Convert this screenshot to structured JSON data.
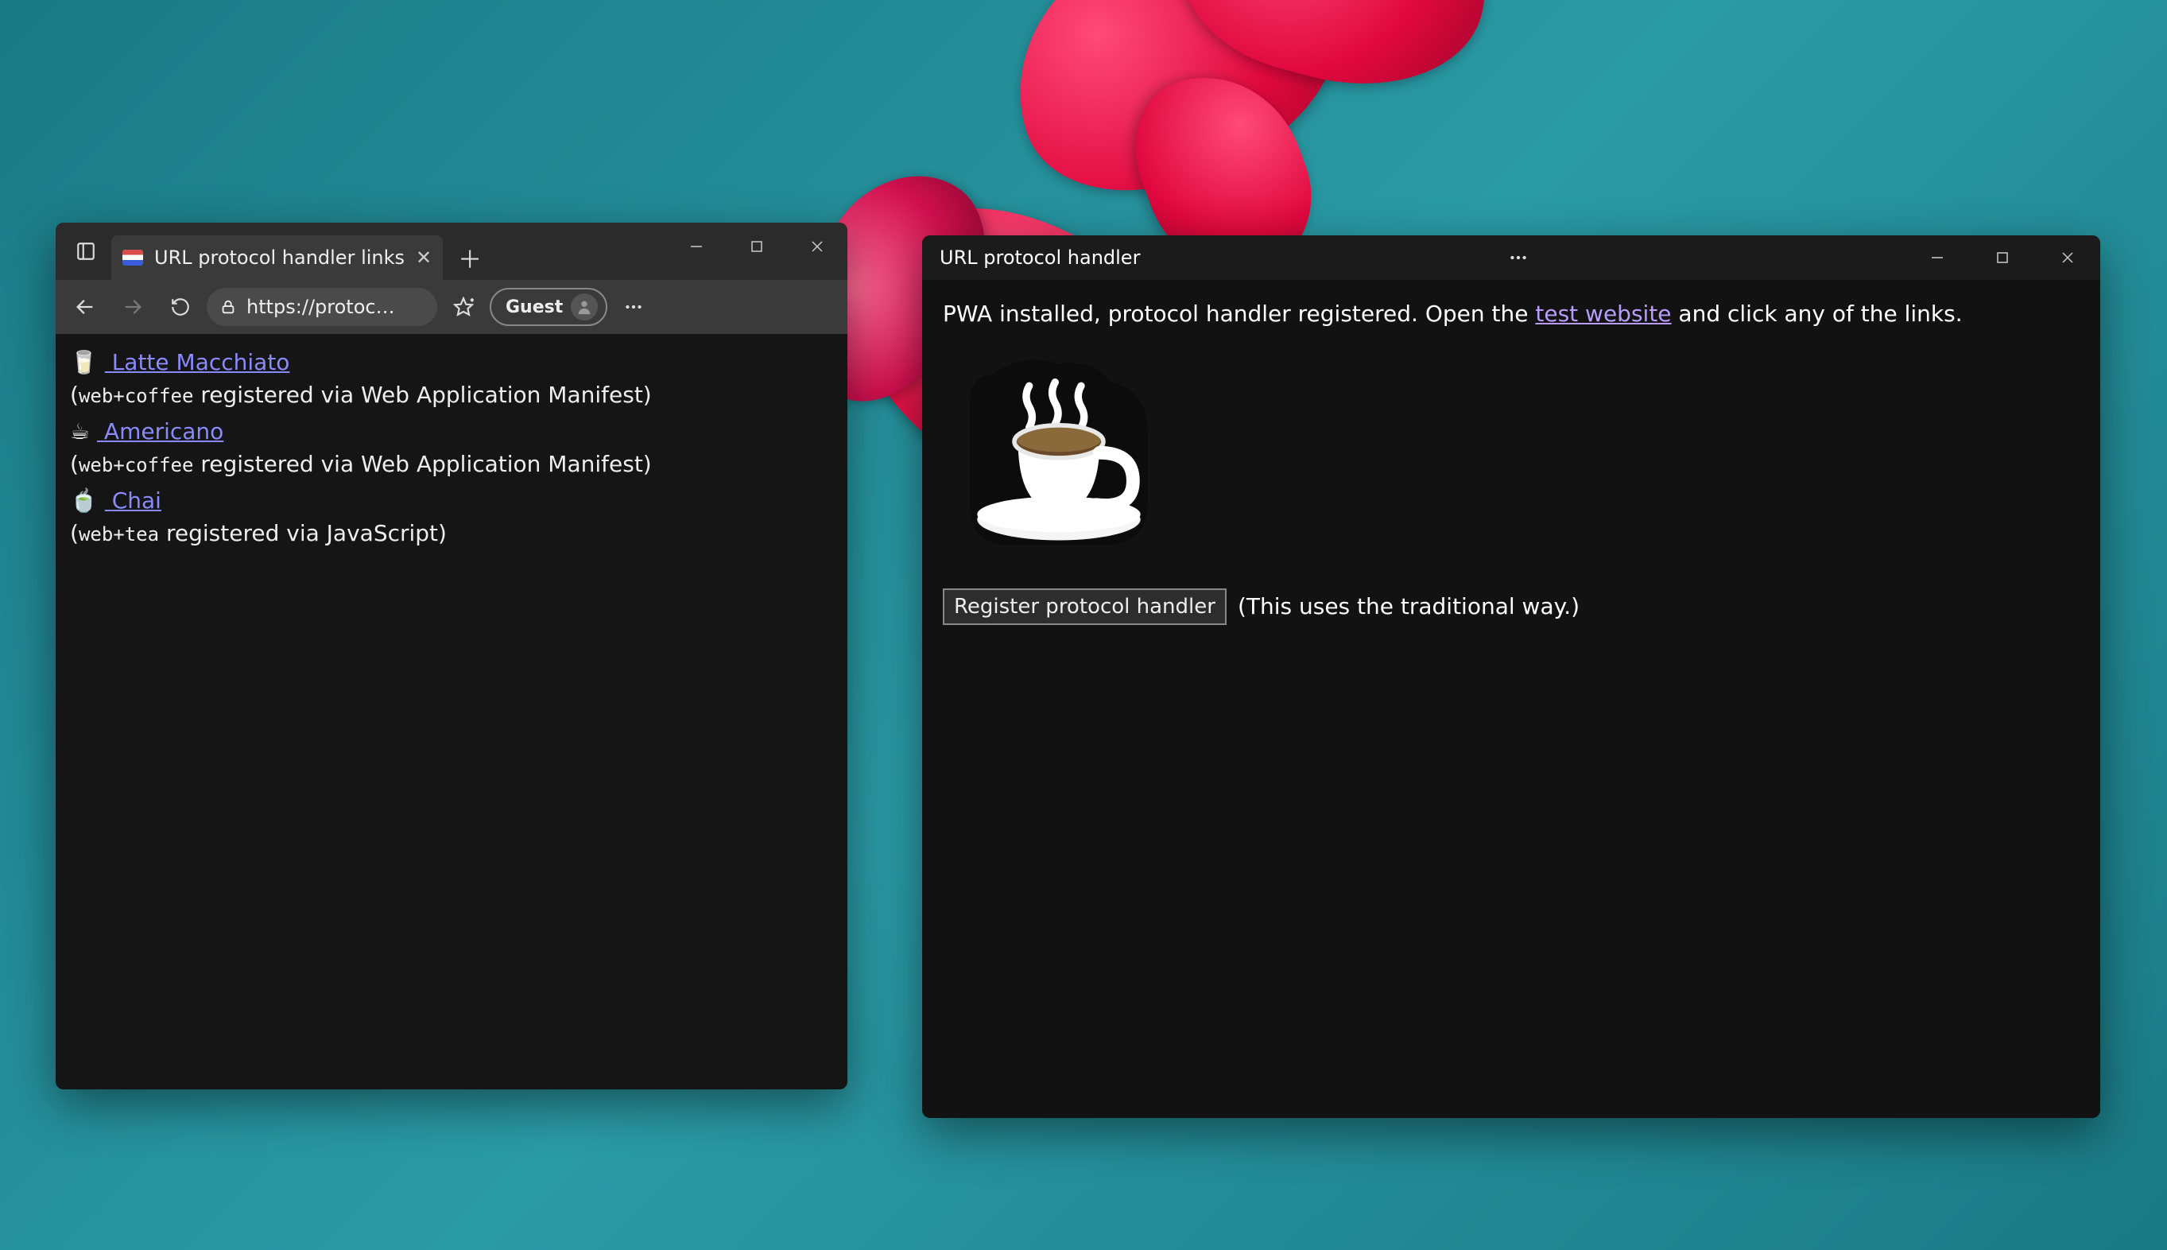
{
  "left": {
    "tab_title": "URL protocol handler links",
    "address": "https://protoc…",
    "guest_label": "Guest",
    "links": [
      {
        "emoji": "🥛",
        "label": "Latte Macchiato",
        "sub_code": "web+coffee",
        "sub_text": " registered via Web Application Manifest)"
      },
      {
        "emoji": "☕",
        "label": "Americano",
        "sub_code": "web+coffee",
        "sub_text": " registered via Web Application Manifest)"
      },
      {
        "emoji": "🍵",
        "label": "Chai",
        "sub_code": "web+tea",
        "sub_text": " registered via JavaScript)"
      }
    ]
  },
  "right": {
    "title": "URL protocol handler",
    "intro_before": "PWA installed, protocol handler registered. Open the ",
    "intro_link": "test website",
    "intro_after": " and click any of the links.",
    "button_label": "Register protocol handler",
    "button_note": "(This uses the traditional way.)"
  }
}
